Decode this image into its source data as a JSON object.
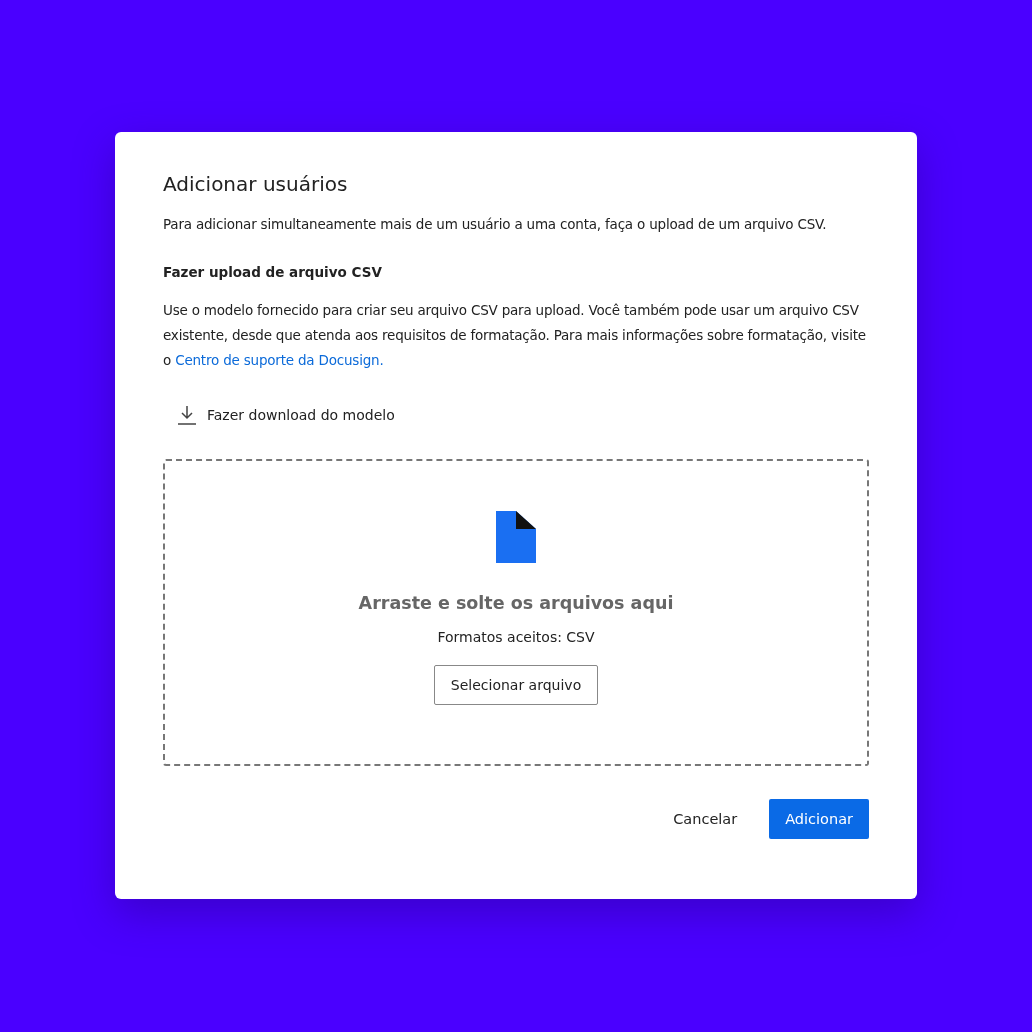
{
  "dialog": {
    "title": "Adicionar usuários",
    "intro": "Para adicionar simultaneamente mais de um usuário a uma conta, faça o upload de um arquivo CSV.",
    "section_title": "Fazer upload de arquivo CSV",
    "description": "Use o modelo fornecido para criar seu arquivo CSV para upload. Você também pode usar um arquivo CSV existente, desde que atenda aos requisitos de formatação. Para mais informações sobre formatação, visite o ",
    "support_link": "Centro de suporte da Docusign.",
    "download_link": "Fazer download do modelo",
    "dropzone": {
      "title": "Arraste e solte os arquivos aqui",
      "formats": "Formatos aceitos: CSV",
      "button": "Selecionar arquivo"
    },
    "buttons": [
      {
        "label": "Cancelar",
        "kind": "secondary"
      },
      {
        "label": "Adicionar",
        "kind": "primary"
      }
    ]
  }
}
